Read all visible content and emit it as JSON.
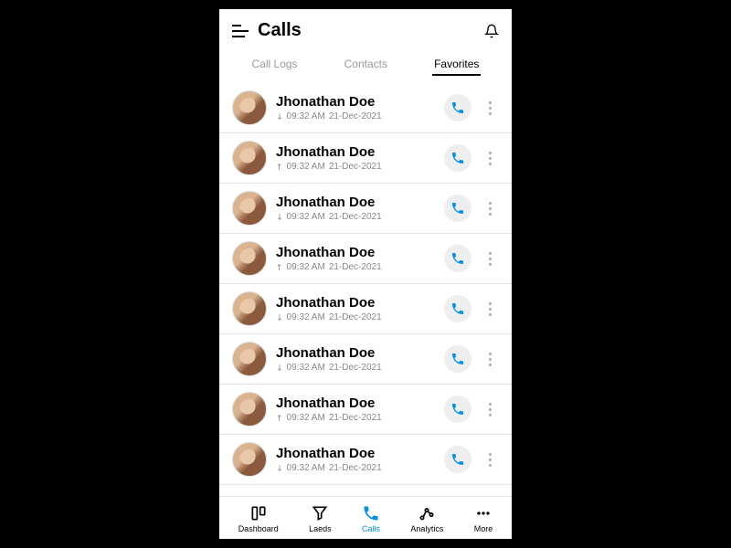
{
  "header": {
    "title": "Calls"
  },
  "tabs": [
    {
      "label": "Call Logs",
      "active": false
    },
    {
      "label": "Contacts",
      "active": false
    },
    {
      "label": "Favorites",
      "active": true
    }
  ],
  "calls": [
    {
      "name": "Jhonathan Doe",
      "dir": "in",
      "time": "09:32 AM",
      "date": "21-Dec-2021"
    },
    {
      "name": "Jhonathan Doe",
      "dir": "out",
      "time": "09:32 AM",
      "date": "21-Dec-2021"
    },
    {
      "name": "Jhonathan Doe",
      "dir": "in",
      "time": "09:32 AM",
      "date": "21-Dec-2021"
    },
    {
      "name": "Jhonathan Doe",
      "dir": "out",
      "time": "09:32 AM",
      "date": "21-Dec-2021"
    },
    {
      "name": "Jhonathan Doe",
      "dir": "in",
      "time": "09:32 AM",
      "date": "21-Dec-2021"
    },
    {
      "name": "Jhonathan Doe",
      "dir": "in",
      "time": "09:32 AM",
      "date": "21-Dec-2021"
    },
    {
      "name": "Jhonathan Doe",
      "dir": "out",
      "time": "09:32 AM",
      "date": "21-Dec-2021"
    },
    {
      "name": "Jhonathan Doe",
      "dir": "in",
      "time": "09:32 AM",
      "date": "21-Dec-2021"
    }
  ],
  "bottomnav": [
    {
      "label": "Dashboard",
      "icon": "dashboard",
      "active": false
    },
    {
      "label": "Laeds",
      "icon": "leads",
      "active": false
    },
    {
      "label": "Calls",
      "icon": "calls",
      "active": true
    },
    {
      "label": "Analytics",
      "icon": "analytics",
      "active": false
    },
    {
      "label": "More",
      "icon": "more",
      "active": false
    }
  ],
  "colors": {
    "accent": "#0091ea"
  }
}
